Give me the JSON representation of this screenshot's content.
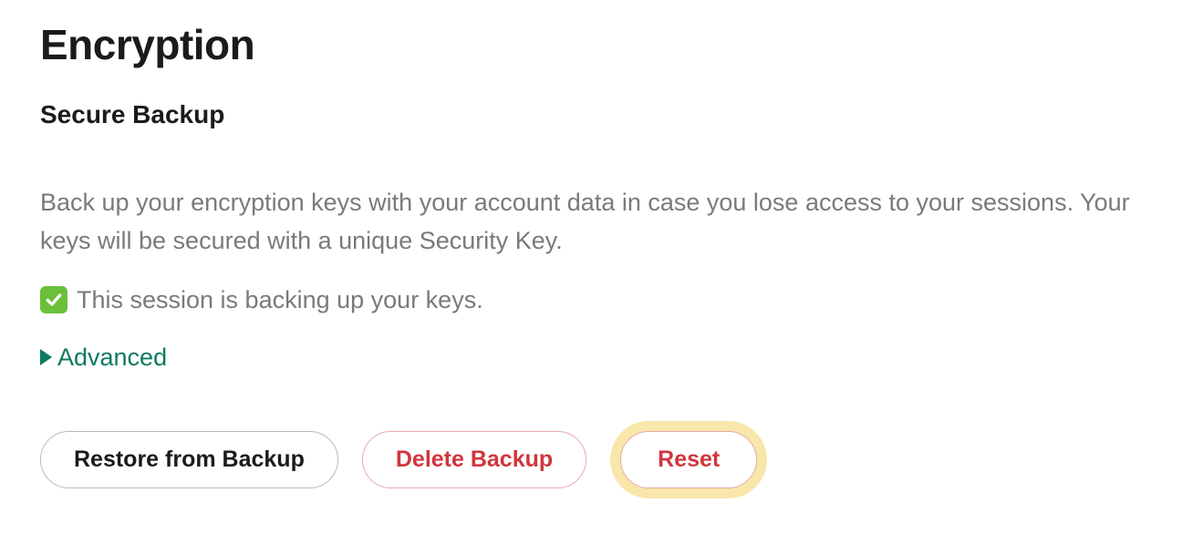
{
  "page_title": "Encryption",
  "section_title": "Secure Backup",
  "description": "Back up your encryption keys with your account data in case you lose access to your sessions. Your keys will be secured with a unique Security Key.",
  "status": {
    "checked": true,
    "text": "This session is backing up your keys."
  },
  "advanced_label": "Advanced",
  "buttons": {
    "restore": "Restore from Backup",
    "delete": "Delete Backup",
    "reset": "Reset"
  },
  "colors": {
    "accent_green": "#0d7a5f",
    "check_bg": "#6bbf3a",
    "danger": "#d0363f",
    "highlight": "#f9e6aa"
  }
}
